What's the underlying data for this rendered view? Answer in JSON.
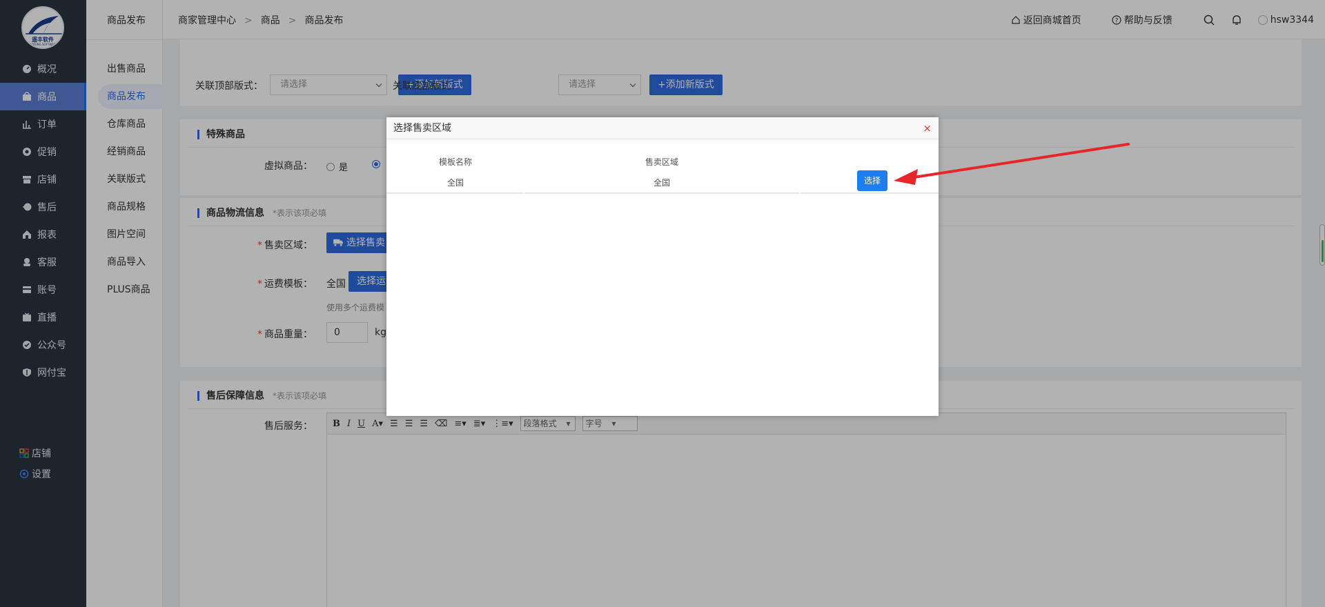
{
  "sidebar": {
    "brand": "遥丰软件",
    "brand_en": "YAOFENG SOFTWARE",
    "items": [
      {
        "label": "概况",
        "icon": "dashboard-icon"
      },
      {
        "label": "商品",
        "icon": "bag-icon"
      },
      {
        "label": "订单",
        "icon": "chart-bars-icon"
      },
      {
        "label": "促销",
        "icon": "promo-icon"
      },
      {
        "label": "店铺",
        "icon": "store-icon"
      },
      {
        "label": "售后",
        "icon": "aftersale-icon"
      },
      {
        "label": "报表",
        "icon": "report-icon"
      },
      {
        "label": "客服",
        "icon": "service-icon"
      },
      {
        "label": "账号",
        "icon": "card-icon"
      },
      {
        "label": "直播",
        "icon": "live-icon"
      },
      {
        "label": "公众号",
        "icon": "wechat-icon"
      },
      {
        "label": "网付宝",
        "icon": "shield-icon"
      }
    ],
    "footer": [
      {
        "label": "店铺",
        "icon": "grid-icon"
      },
      {
        "label": "设置",
        "icon": "gear-icon"
      }
    ]
  },
  "subnav": {
    "title": "商品发布",
    "items": [
      "出售商品",
      "商品发布",
      "仓库商品",
      "经销商品",
      "关联版式",
      "商品规格",
      "图片空间",
      "商品导入",
      "PLUS商品"
    ]
  },
  "topbar": {
    "breadcrumb": [
      "商家管理中心",
      "商品",
      "商品发布"
    ],
    "home_link": "返回商城首页",
    "help_link": "帮助与反馈",
    "username": "hsw3344"
  },
  "form": {
    "top_format_label": "关联顶部版式：",
    "bottom_format_label": "关联底部版式：",
    "select_placeholder": "请选择",
    "add_format_button": "+添加新版式",
    "special_section": "特殊商品",
    "virtual_label": "虚拟商品：",
    "virtual_yes": "是",
    "logistics_section": "商品物流信息",
    "required_hint": "*表示该项必填",
    "sale_area_label": "售卖区域：",
    "sale_area_button": "选择售卖",
    "freight_label": "运费模板：",
    "freight_value": "全国",
    "freight_button": "选择运",
    "freight_hint": "使用多个运费模",
    "weight_label": "商品重量：",
    "weight_value": "0",
    "weight_unit": "kg",
    "aftersale_section": "售后保障信息",
    "service_label": "售后服务：",
    "editor_paragraph": "段落格式",
    "editor_fontsize": "字号"
  },
  "modal": {
    "title": "选择售卖区域",
    "close": "×",
    "col_template": "模板名称",
    "col_area": "售卖区域",
    "row_template": "全国",
    "row_area": "全国",
    "select_button": "选择"
  },
  "colors": {
    "sidebar_bg": "#2b3440",
    "primary": "#2f6ce0",
    "select_button": "#1e7ef0",
    "annotation_arrow": "#e8262a"
  }
}
